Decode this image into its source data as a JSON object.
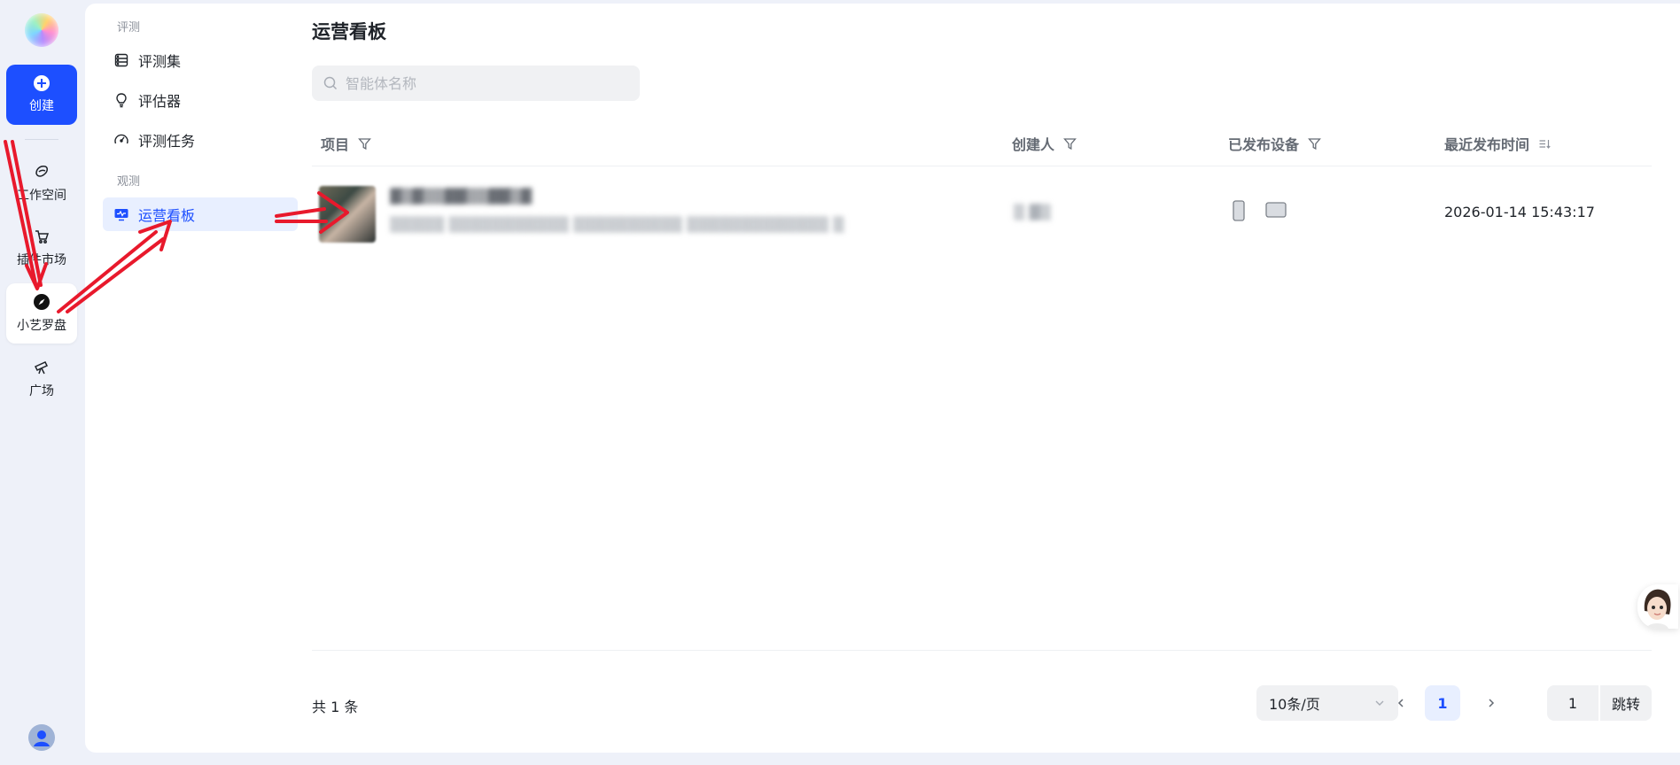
{
  "rail": {
    "create_label": "创建",
    "items": [
      {
        "label": "工作空间",
        "icon": "workspace-icon"
      },
      {
        "label": "插件市场",
        "icon": "cart-icon"
      },
      {
        "label": "小艺罗盘",
        "icon": "compass-icon"
      },
      {
        "label": "广场",
        "icon": "telescope-icon"
      }
    ]
  },
  "subnav": {
    "group1": "评测",
    "group2": "观测",
    "items": [
      {
        "label": "评测集",
        "icon": "database-icon"
      },
      {
        "label": "评估器",
        "icon": "bulb-icon"
      },
      {
        "label": "评测任务",
        "icon": "gauge-icon"
      },
      {
        "label": "运营看板",
        "icon": "monitor-icon"
      }
    ]
  },
  "page": {
    "title": "运营看板",
    "search_placeholder": "智能体名称"
  },
  "table": {
    "headers": [
      "项目",
      "创建人",
      "已发布设备",
      "最近发布时间"
    ],
    "rows": [
      {
        "publish_time": "2026-01-14 15:43:17",
        "devices": [
          "phone-icon",
          "tablet-icon"
        ]
      }
    ]
  },
  "pagination": {
    "total": "共 1 条",
    "page_size": "10条/页",
    "current": "1",
    "jump_value": "1",
    "jump_label": "跳转"
  },
  "colors": {
    "accent": "#1d4fff",
    "annotation": "#e8192c"
  }
}
